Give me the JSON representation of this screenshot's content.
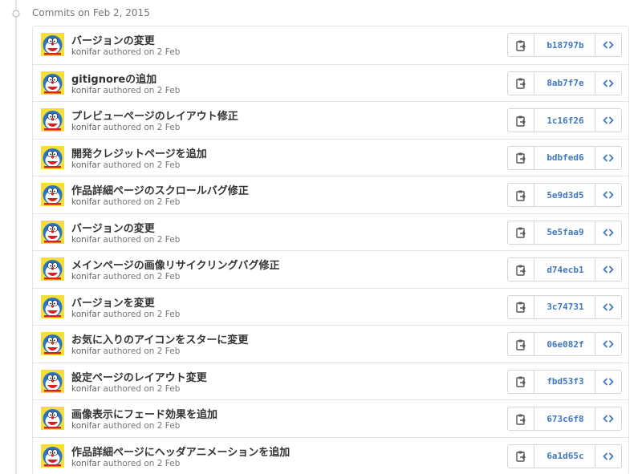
{
  "group": {
    "title": "Commits on Feb 2, 2015"
  },
  "colors": {
    "sha": "#4078c0",
    "border": "#e5e5e5",
    "meta": "#767676"
  },
  "icons": {
    "copy": "clippy-icon",
    "browse": "code-icon",
    "dot": "commit-dot-icon"
  },
  "commits": [
    {
      "title": "バージョンの変更",
      "author": "konifar",
      "meta": "authored on 2 Feb",
      "sha": "b18797b"
    },
    {
      "title": "gitignoreの追加",
      "author": "konifar",
      "meta": "authored on 2 Feb",
      "sha": "8ab7f7e"
    },
    {
      "title": "プレビューページのレイアウト修正",
      "author": "konifar",
      "meta": "authored on 2 Feb",
      "sha": "1c16f26"
    },
    {
      "title": "開発クレジットページを追加",
      "author": "konifar",
      "meta": "authored on 2 Feb",
      "sha": "bdbfed6"
    },
    {
      "title": "作品詳細ページのスクロールバグ修正",
      "author": "konifar",
      "meta": "authored on 2 Feb",
      "sha": "5e9d3d5"
    },
    {
      "title": "バージョンの変更",
      "author": "konifar",
      "meta": "authored on 2 Feb",
      "sha": "5e5faa9"
    },
    {
      "title": "メインページの画像リサイクリングバグ修正",
      "author": "konifar",
      "meta": "authored on 2 Feb",
      "sha": "d74ecb1"
    },
    {
      "title": "バージョンを変更",
      "author": "konifar",
      "meta": "authored on 2 Feb",
      "sha": "3c74731"
    },
    {
      "title": "お気に入りのアイコンをスターに変更",
      "author": "konifar",
      "meta": "authored on 2 Feb",
      "sha": "06e082f"
    },
    {
      "title": "設定ページのレイアウト変更",
      "author": "konifar",
      "meta": "authored on 2 Feb",
      "sha": "fbd53f3"
    },
    {
      "title": "画像表示にフェード効果を追加",
      "author": "konifar",
      "meta": "authored on 2 Feb",
      "sha": "673c6f8"
    },
    {
      "title": "作品詳細ページにヘッダアニメーションを追加",
      "author": "konifar",
      "meta": "authored on 2 Feb",
      "sha": "6a1d65c"
    }
  ]
}
